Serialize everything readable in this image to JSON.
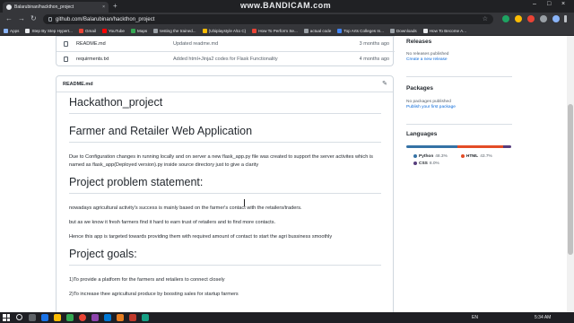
{
  "browser": {
    "tab_title": "Balarubinan/hackthon_project",
    "tab_close": "×",
    "new_tab": "+",
    "watermark": "www.BANDICAM.com",
    "url": "github.com/Balarubinan/hackthon_project",
    "back": "←",
    "forward": "→",
    "reload": "↻",
    "star": "☆",
    "minimize": "–",
    "maximize": "□",
    "close": "×"
  },
  "bookmarks": [
    {
      "label": "Apps",
      "color": "#8ab4f8"
    },
    {
      "label": "Step By Step Hypert...",
      "color": "#e8eaed"
    },
    {
      "label": "Gmail",
      "color": "#ea4335"
    },
    {
      "label": "YouTube",
      "color": "#ff0000"
    },
    {
      "label": "Maps",
      "color": "#34a853"
    },
    {
      "label": "testing the trained...",
      "color": "#9aa0a6"
    },
    {
      "label": "(Ubiplaystyle A\\to C)",
      "color": "#fbbc04"
    },
    {
      "label": "How To Perform Se...",
      "color": "#ea4335"
    },
    {
      "label": "actual code",
      "color": "#9aa0a6"
    },
    {
      "label": "Top Arts Colleges In...",
      "color": "#4285f4"
    },
    {
      "label": "Downloads",
      "color": "#9aa0a6"
    },
    {
      "label": "How To Become A...",
      "color": "#e8eaed"
    }
  ],
  "files": [
    {
      "name": "README.md",
      "message": "Updated readme.md",
      "age": "3 months ago"
    },
    {
      "name": "requirments.txt",
      "message": "Added html+Jinja2 codes for Flask Functionality",
      "age": "4 months ago"
    }
  ],
  "readme": {
    "label": "README.md",
    "edit_icon": "✎",
    "h_title": "Hackathon_project",
    "h_app": "Farmer and Retailer Web Application",
    "p_config": "Due to Configuration changes in running locally and on server a new flask_app.py file was created to support the server activites which is named as flask_app(Deployed version).py inside source directory just to give a clarity",
    "h_problem": "Project problem statement:",
    "p1": "nowadays agricultural activity's success is mainly based on the farmer's contact with the retailers/traders.",
    "p2": "but as we know it fresh farmers find it hard to earn trust of retailers and to find more contacts.",
    "p3": "Hence this app is targeted towards providing them with required amount of contact to start the agri bussiness smoothly",
    "h_goals": "Project goals:",
    "g1": "1)To provide a platform for the farmers and retailers to connect closely",
    "g2": "2)To increase thee agricultural produce by boosting sales for startup farmers"
  },
  "sidebar": {
    "releases_title": "Releases",
    "releases_text": "No releases published",
    "releases_link": "Create a new release",
    "packages_title": "Packages",
    "packages_text": "No packages published",
    "packages_link": "Publish your first package",
    "languages_title": "Languages",
    "languages": [
      {
        "name": "Python",
        "pct": "48.3%",
        "value": 48.3,
        "color": "#3572a5"
      },
      {
        "name": "HTML",
        "pct": "43.7%",
        "value": 43.7,
        "color": "#e34c26"
      },
      {
        "name": "CSS",
        "pct": "8.0%",
        "value": 8.0,
        "color": "#563d7c"
      }
    ]
  },
  "taskbar": {
    "lang": "EN",
    "time": "5:34 AM"
  }
}
